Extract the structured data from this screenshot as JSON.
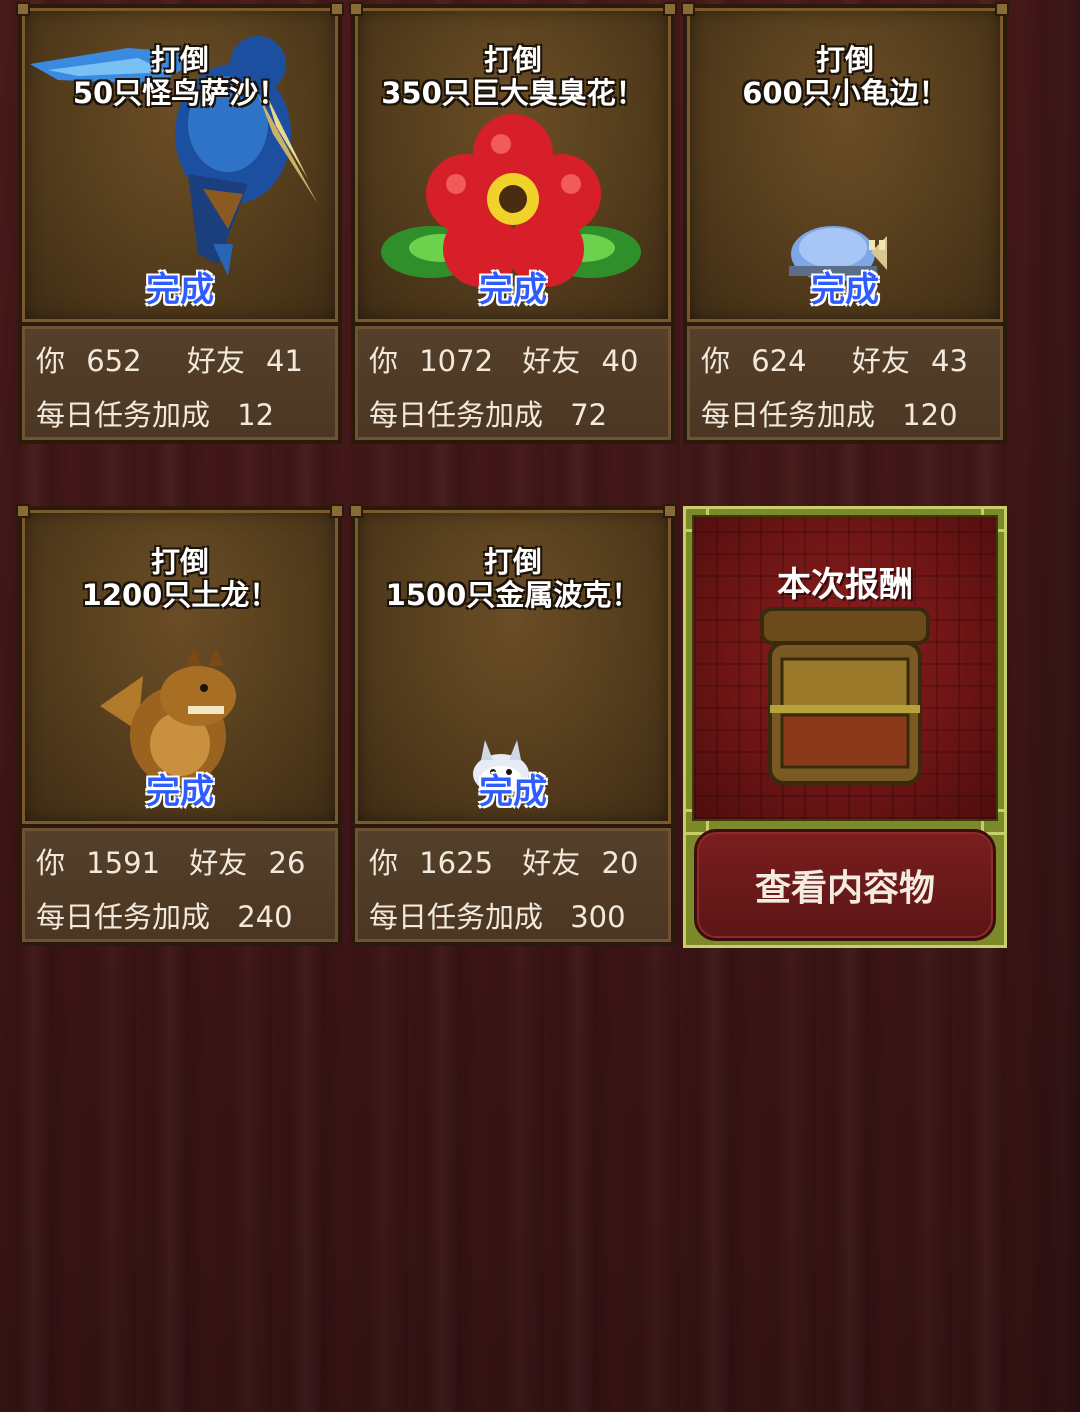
{
  "colors": {
    "background": "#4a1a1b",
    "card": "#58401e",
    "done_text": "#2f5cff",
    "reward_panel": "#7d8a2a"
  },
  "cards": [
    {
      "title_line1": "打倒",
      "title_line2": "50只怪鸟萨沙！",
      "status": "完成",
      "you_label": "你",
      "you_value": "652",
      "friend_label": "好友",
      "friend_value": "41",
      "bonus_label": "每日任务加成",
      "bonus_value": "12",
      "monster_icon": "kingfisher-bird-icon"
    },
    {
      "title_line1": "打倒",
      "title_line2": "350只巨大臭臭花！",
      "status": "完成",
      "you_label": "你",
      "you_value": "1072",
      "friend_label": "好友",
      "friend_value": "40",
      "bonus_label": "每日任务加成",
      "bonus_value": "72",
      "monster_icon": "giant-flower-icon"
    },
    {
      "title_line1": "打倒",
      "title_line2": "600只小龟边！",
      "status": "完成",
      "you_label": "你",
      "you_value": "624",
      "friend_label": "好友",
      "friend_value": "43",
      "bonus_label": "每日任务加成",
      "bonus_value": "120",
      "monster_icon": "small-turtle-icon"
    },
    {
      "title_line1": "打倒",
      "title_line2": "1200只土龙！",
      "status": "完成",
      "you_label": "你",
      "you_value": "1591",
      "friend_label": "好友",
      "friend_value": "26",
      "bonus_label": "每日任务加成",
      "bonus_value": "240",
      "monster_icon": "earth-dragon-icon"
    },
    {
      "title_line1": "打倒",
      "title_line2": "1500只金属波克！",
      "status": "完成",
      "you_label": "你",
      "you_value": "1625",
      "friend_label": "好友",
      "friend_value": "20",
      "bonus_label": "每日任务加成",
      "bonus_value": "300",
      "monster_icon": "metal-bunny-icon"
    }
  ],
  "reward": {
    "title": "本次报酬",
    "button_label": "查看内容物",
    "icon": "treasure-chest-icon"
  }
}
